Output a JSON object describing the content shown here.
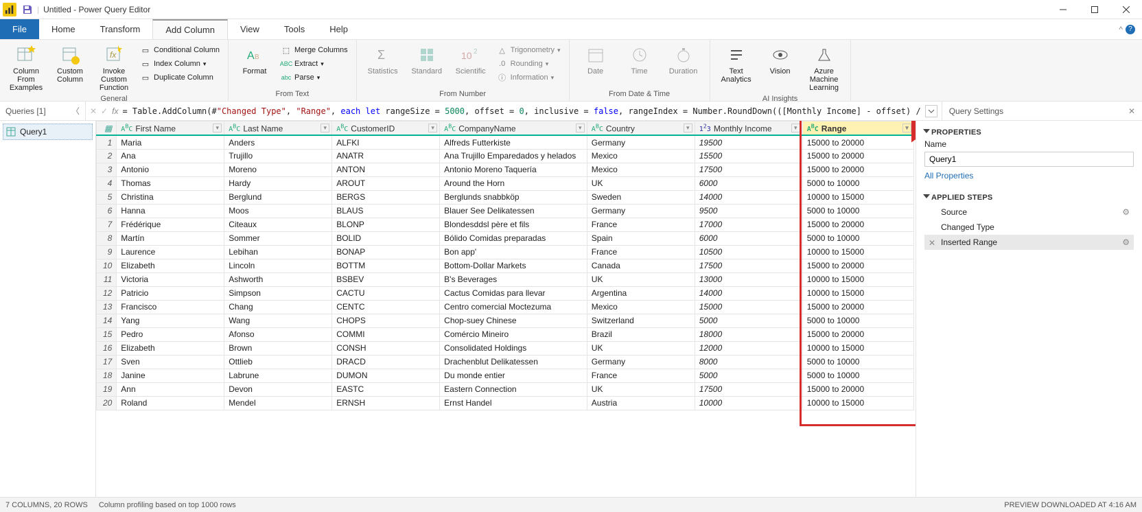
{
  "title": "Untitled - Power Query Editor",
  "menu": {
    "file": "File",
    "home": "Home",
    "transform": "Transform",
    "addcolumn": "Add Column",
    "view": "View",
    "tools": "Tools",
    "help": "Help"
  },
  "ribbon": {
    "general": {
      "col_examples": "Column From Examples",
      "custom": "Custom Column",
      "invoke": "Invoke Custom Function",
      "cond": "Conditional Column",
      "index": "Index Column",
      "dup": "Duplicate Column",
      "label": "General"
    },
    "from_text": {
      "format": "Format",
      "merge": "Merge Columns",
      "extract": "Extract",
      "parse": "Parse",
      "label": "From Text"
    },
    "from_number": {
      "stats": "Statistics",
      "standard": "Standard",
      "sci": "Scientific",
      "trig": "Trigonometry",
      "round": "Rounding",
      "info": "Information",
      "label": "From Number"
    },
    "from_datetime": {
      "date": "Date",
      "time": "Time",
      "duration": "Duration",
      "label": "From Date & Time"
    },
    "ai": {
      "text": "Text Analytics",
      "vision": "Vision",
      "aml": "Azure Machine Learning",
      "label": "AI Insights"
    }
  },
  "queries_header": "Queries [1]",
  "query_item": "Query1",
  "query_settings": "Query Settings",
  "properties_section": "PROPERTIES",
  "name_label": "Name",
  "name_value": "Query1",
  "all_properties": "All Properties",
  "applied_steps_section": "APPLIED STEPS",
  "steps": [
    "Source",
    "Changed Type",
    "Inserted Range"
  ],
  "formula_parts": {
    "prefix": "= Table.AddColumn(#",
    "q1": "\"Changed Type\"",
    "c1": ", ",
    "q2": "\"Range\"",
    "c2": ", ",
    "kw1": "each let",
    "t1": " rangeSize = ",
    "n1": "5000",
    "t2": ", offset = ",
    "n2": "0",
    "t3": ", inclusive = ",
    "kw2": "false",
    "t4": ", rangeIndex = Number.RoundDown(([Monthly Income] - offset) /"
  },
  "columns": [
    {
      "key": "FirstName",
      "label": "First Name",
      "type": "text"
    },
    {
      "key": "LastName",
      "label": "Last Name",
      "type": "text"
    },
    {
      "key": "CustomerID",
      "label": "CustomerID",
      "type": "text"
    },
    {
      "key": "CompanyName",
      "label": "CompanyName",
      "type": "text"
    },
    {
      "key": "Country",
      "label": "Country",
      "type": "text"
    },
    {
      "key": "MonthlyIncome",
      "label": "Monthly Income",
      "type": "num"
    },
    {
      "key": "Range",
      "label": "Range",
      "type": "text"
    }
  ],
  "rows": [
    {
      "FirstName": "Maria",
      "LastName": "Anders",
      "CustomerID": "ALFKI",
      "CompanyName": "Alfreds Futterkiste",
      "Country": "Germany",
      "MonthlyIncome": "19500",
      "Range": "15000 to 20000"
    },
    {
      "FirstName": "Ana",
      "LastName": "Trujillo",
      "CustomerID": "ANATR",
      "CompanyName": "Ana Trujillo Emparedados y helados",
      "Country": "Mexico",
      "MonthlyIncome": "15500",
      "Range": "15000 to 20000"
    },
    {
      "FirstName": "Antonio",
      "LastName": "Moreno",
      "CustomerID": "ANTON",
      "CompanyName": "Antonio Moreno Taquería",
      "Country": "Mexico",
      "MonthlyIncome": "17500",
      "Range": "15000 to 20000"
    },
    {
      "FirstName": "Thomas",
      "LastName": "Hardy",
      "CustomerID": "AROUT",
      "CompanyName": "Around the Horn",
      "Country": "UK",
      "MonthlyIncome": "6000",
      "Range": "5000 to 10000"
    },
    {
      "FirstName": "Christina",
      "LastName": "Berglund",
      "CustomerID": "BERGS",
      "CompanyName": "Berglunds snabbköp",
      "Country": "Sweden",
      "MonthlyIncome": "14000",
      "Range": "10000 to 15000"
    },
    {
      "FirstName": "Hanna",
      "LastName": "Moos",
      "CustomerID": "BLAUS",
      "CompanyName": "Blauer See Delikatessen",
      "Country": "Germany",
      "MonthlyIncome": "9500",
      "Range": "5000 to 10000"
    },
    {
      "FirstName": "Frédérique",
      "LastName": "Citeaux",
      "CustomerID": "BLONP",
      "CompanyName": "Blondesddsl père et fils",
      "Country": "France",
      "MonthlyIncome": "17000",
      "Range": "15000 to 20000"
    },
    {
      "FirstName": "Martín",
      "LastName": "Sommer",
      "CustomerID": "BOLID",
      "CompanyName": "Bólido Comidas preparadas",
      "Country": "Spain",
      "MonthlyIncome": "6000",
      "Range": "5000 to 10000"
    },
    {
      "FirstName": "Laurence",
      "LastName": "Lebihan",
      "CustomerID": "BONAP",
      "CompanyName": "Bon app'",
      "Country": "France",
      "MonthlyIncome": "10500",
      "Range": "10000 to 15000"
    },
    {
      "FirstName": "Elizabeth",
      "LastName": "Lincoln",
      "CustomerID": "BOTTM",
      "CompanyName": "Bottom-Dollar Markets",
      "Country": "Canada",
      "MonthlyIncome": "17500",
      "Range": "15000 to 20000"
    },
    {
      "FirstName": "Victoria",
      "LastName": "Ashworth",
      "CustomerID": "BSBEV",
      "CompanyName": "B's Beverages",
      "Country": "UK",
      "MonthlyIncome": "13000",
      "Range": "10000 to 15000"
    },
    {
      "FirstName": "Patricio",
      "LastName": "Simpson",
      "CustomerID": "CACTU",
      "CompanyName": "Cactus Comidas para llevar",
      "Country": "Argentina",
      "MonthlyIncome": "14000",
      "Range": "10000 to 15000"
    },
    {
      "FirstName": "Francisco",
      "LastName": "Chang",
      "CustomerID": "CENTC",
      "CompanyName": "Centro comercial Moctezuma",
      "Country": "Mexico",
      "MonthlyIncome": "15000",
      "Range": "15000 to 20000"
    },
    {
      "FirstName": "Yang",
      "LastName": "Wang",
      "CustomerID": "CHOPS",
      "CompanyName": "Chop-suey Chinese",
      "Country": "Switzerland",
      "MonthlyIncome": "5000",
      "Range": "5000 to 10000"
    },
    {
      "FirstName": "Pedro",
      "LastName": "Afonso",
      "CustomerID": "COMMI",
      "CompanyName": "Comércio Mineiro",
      "Country": "Brazil",
      "MonthlyIncome": "18000",
      "Range": "15000 to 20000"
    },
    {
      "FirstName": "Elizabeth",
      "LastName": "Brown",
      "CustomerID": "CONSH",
      "CompanyName": "Consolidated Holdings",
      "Country": "UK",
      "MonthlyIncome": "12000",
      "Range": "10000 to 15000"
    },
    {
      "FirstName": "Sven",
      "LastName": "Ottlieb",
      "CustomerID": "DRACD",
      "CompanyName": "Drachenblut Delikatessen",
      "Country": "Germany",
      "MonthlyIncome": "8000",
      "Range": "5000 to 10000"
    },
    {
      "FirstName": "Janine",
      "LastName": "Labrune",
      "CustomerID": "DUMON",
      "CompanyName": "Du monde entier",
      "Country": "France",
      "MonthlyIncome": "5000",
      "Range": "5000 to 10000"
    },
    {
      "FirstName": "Ann",
      "LastName": "Devon",
      "CustomerID": "EASTC",
      "CompanyName": "Eastern Connection",
      "Country": "UK",
      "MonthlyIncome": "17500",
      "Range": "15000 to 20000"
    },
    {
      "FirstName": "Roland",
      "LastName": "Mendel",
      "CustomerID": "ERNSH",
      "CompanyName": "Ernst Handel",
      "Country": "Austria",
      "MonthlyIncome": "10000",
      "Range": "10000 to 15000"
    }
  ],
  "status": {
    "left": "7 COLUMNS, 20 ROWS",
    "mid": "Column profiling based on top 1000 rows",
    "right": "PREVIEW DOWNLOADED AT 4:16 AM"
  },
  "col_widths": {
    "FirstName": 150,
    "LastName": 150,
    "CustomerID": 150,
    "CompanyName": 198,
    "Country": 150,
    "MonthlyIncome": 150,
    "Range": 155
  }
}
